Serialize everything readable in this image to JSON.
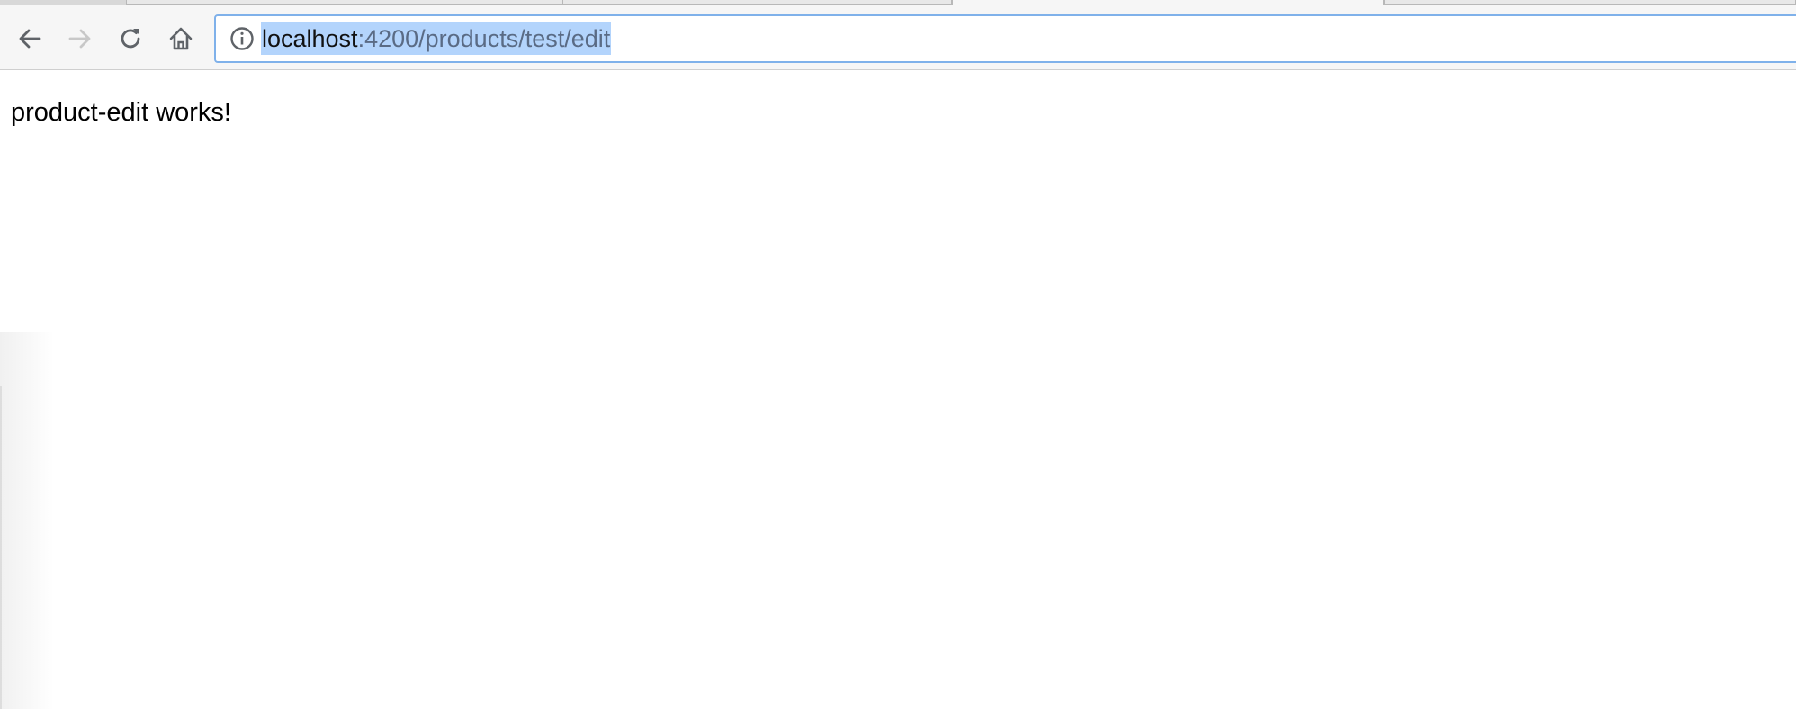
{
  "browser": {
    "toolbar": {
      "back_icon": "arrow-left-icon",
      "forward_icon": "arrow-right-icon",
      "reload_icon": "reload-icon",
      "home_icon": "home-icon"
    },
    "omnibox": {
      "info_icon": "info-icon",
      "url_host": "localhost",
      "url_path": ":4200/products/test/edit",
      "selected": true
    }
  },
  "page": {
    "body_text": "product-edit works!"
  },
  "colors": {
    "selection": "#b3d4fc",
    "omnibox_focus_border": "#7fb1ea",
    "url_path": "#5a6b85",
    "toolbar_bg": "#f6f6f6"
  }
}
